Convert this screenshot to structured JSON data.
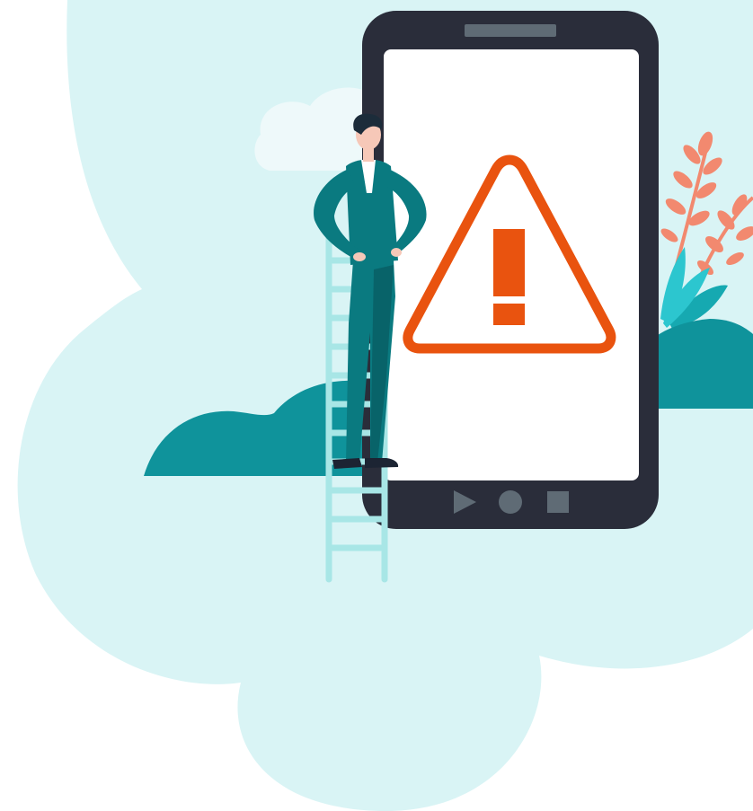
{
  "illustration": {
    "subject": "warning-on-phone",
    "colors": {
      "cloud": "#d9f4f5",
      "small_cloud": "#eef9fa",
      "hill": "#0f939b",
      "phone_body": "#2a2d3a",
      "phone_screen": "#ffffff",
      "speaker": "#5f6b75",
      "nav_buttons": "#5f6b75",
      "warning": "#e9530f",
      "ladder": "#a8e6e6",
      "suit": "#0a7a80",
      "suit_shadow": "#086369",
      "skin": "#f6c8b8",
      "hair": "#1c2c3a",
      "shirt": "#ffffff",
      "shoes": "#1c2433",
      "plant_leaf": "#2cc6cf",
      "plant_leaf_dark": "#16a9b1",
      "coral": "#f2896f"
    },
    "icons": {
      "warning": "warning-triangle-icon",
      "back": "play-triangle-icon",
      "home": "circle-home-icon",
      "recent": "square-recent-icon"
    }
  }
}
